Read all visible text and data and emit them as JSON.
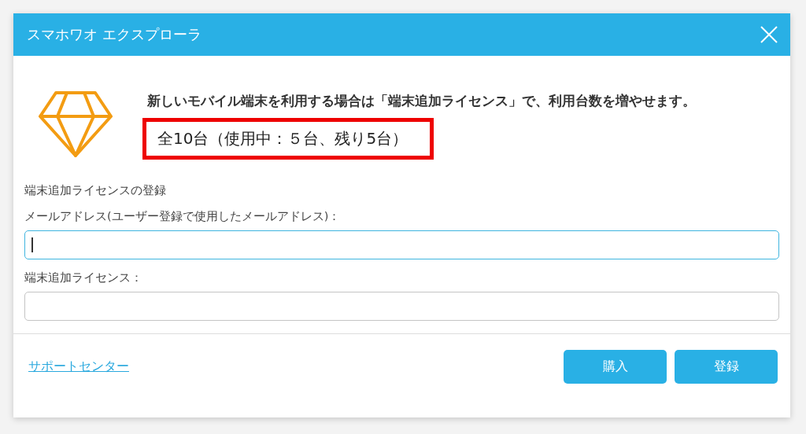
{
  "window": {
    "title": "スマホワオ エクスプローラ"
  },
  "message": {
    "text": "新しいモバイル端末を利用する場合は「端末追加ライセンス」で、利用台数を増やせます。",
    "count": "全10台（使用中：５台、残り5台）",
    "highlighted": true
  },
  "section_title": "端末追加ライセンスの登録",
  "fields": [
    {
      "label": "メールアドレス(ユーザー登録で使用したメールアドレス)：",
      "focused": true
    },
    {
      "label": "端末追加ライセンス：",
      "focused": false
    }
  ],
  "footer": {
    "link": "サポートセンター",
    "buttons": [
      "購入",
      "登録"
    ]
  }
}
